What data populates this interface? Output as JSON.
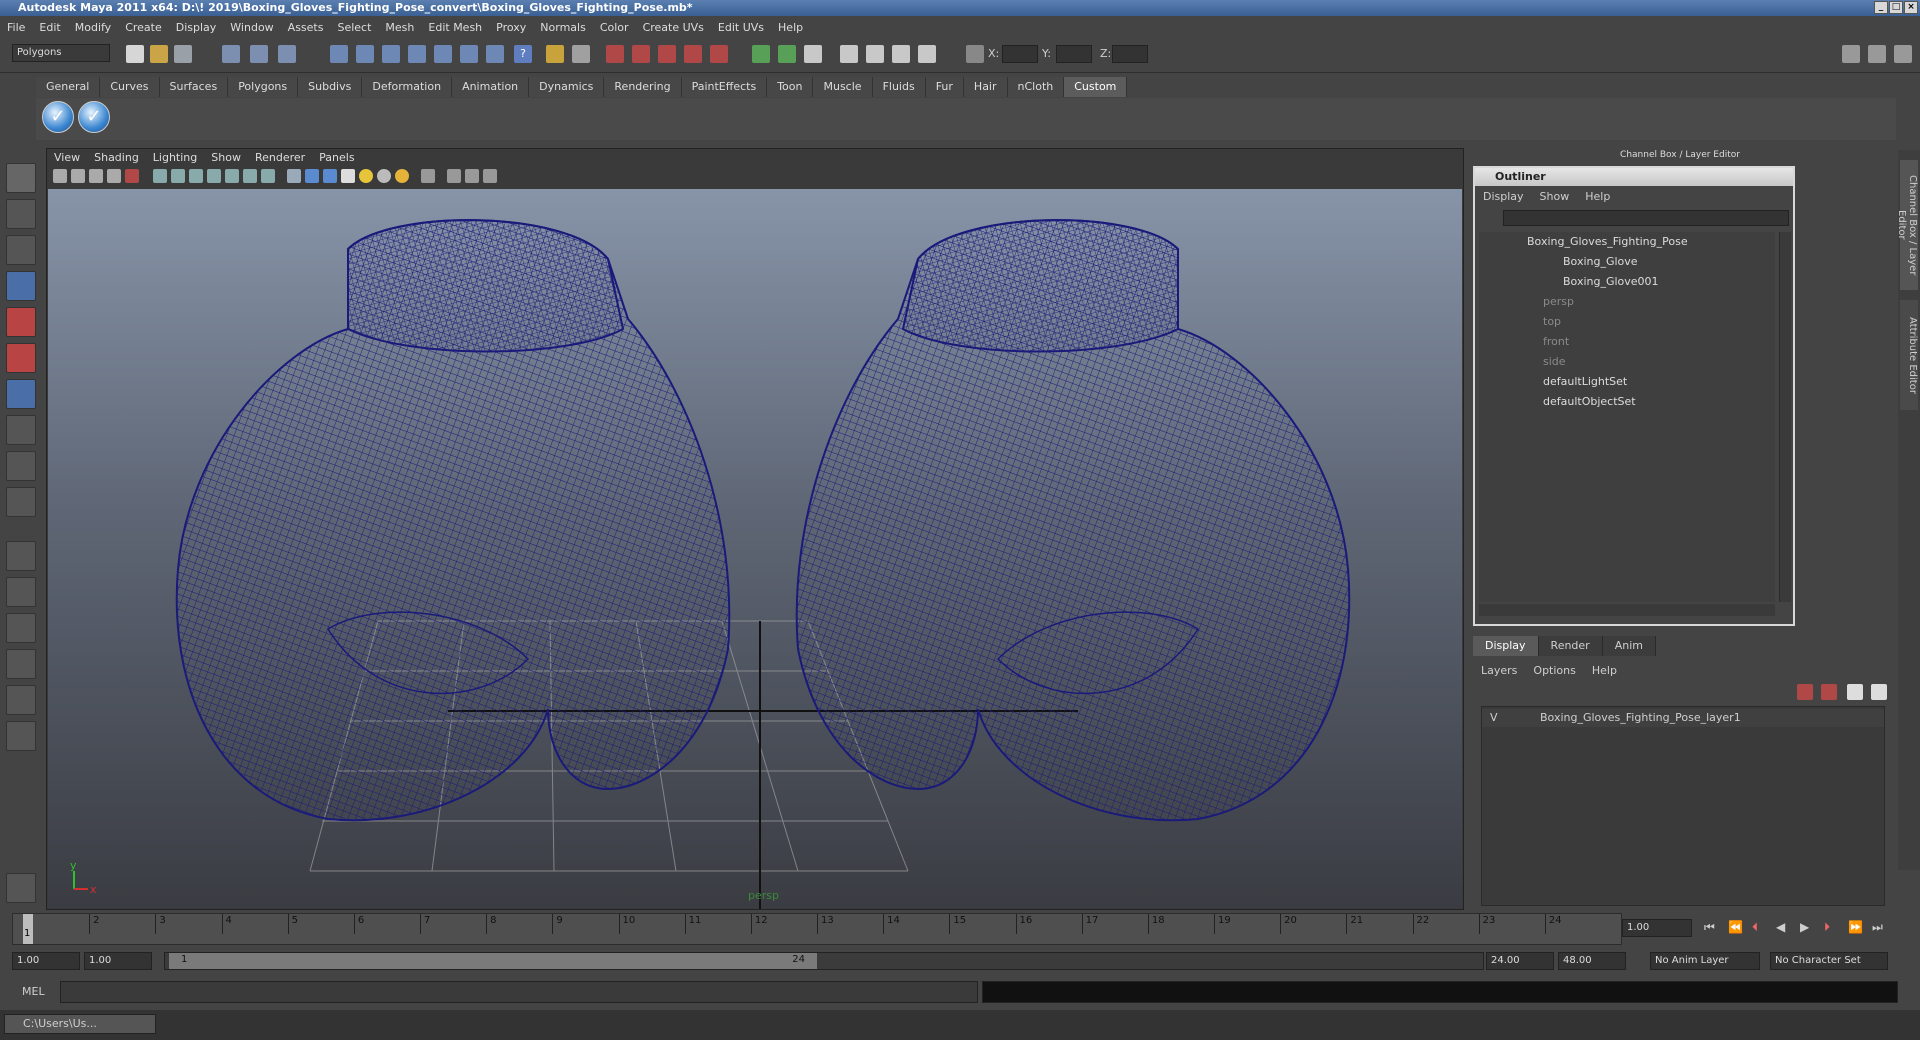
{
  "window": {
    "title": "Autodesk Maya 2011 x64: D:\\! 2019\\Boxing_Gloves_Fighting_Pose_convert\\Boxing_Gloves_Fighting_Pose.mb*"
  },
  "menubar": [
    "File",
    "Edit",
    "Modify",
    "Create",
    "Display",
    "Window",
    "Assets",
    "Select",
    "Mesh",
    "Edit Mesh",
    "Proxy",
    "Normals",
    "Color",
    "Create UVs",
    "Edit UVs",
    "Help"
  ],
  "status": {
    "mode": "Polygons",
    "x_label": "X:",
    "y_label": "Y:",
    "z_label": "Z:"
  },
  "shelf": {
    "tabs": [
      "General",
      "Curves",
      "Surfaces",
      "Polygons",
      "Subdivs",
      "Deformation",
      "Animation",
      "Dynamics",
      "Rendering",
      "PaintEffects",
      "Toon",
      "Muscle",
      "Fluids",
      "Fur",
      "Hair",
      "nCloth",
      "Custom"
    ],
    "active": "Custom"
  },
  "viewport": {
    "menu": [
      "View",
      "Shading",
      "Lighting",
      "Show",
      "Renderer",
      "Panels"
    ],
    "camera_label": "persp",
    "axis_y": "y",
    "axis_x": "x",
    "wire_color": "#1a1a7a"
  },
  "channelbox": {
    "header": "Channel Box / Layer Editor",
    "side_tabs": [
      "Channel Box / Layer Editor",
      "Attribute Editor"
    ]
  },
  "outliner": {
    "title": "Outliner",
    "menu": [
      "Display",
      "Show",
      "Help"
    ],
    "items": [
      {
        "label": "Boxing_Gloves_Fighting_Pose",
        "dim": false
      },
      {
        "label": "Boxing_Glove",
        "dim": false
      },
      {
        "label": "Boxing_Glove001",
        "dim": false
      },
      {
        "label": "persp",
        "dim": true
      },
      {
        "label": "top",
        "dim": true
      },
      {
        "label": "front",
        "dim": true
      },
      {
        "label": "side",
        "dim": true
      },
      {
        "label": "defaultLightSet",
        "dim": false
      },
      {
        "label": "defaultObjectSet",
        "dim": false
      }
    ]
  },
  "layers": {
    "tabs": [
      "Display",
      "Render",
      "Anim"
    ],
    "active": "Display",
    "menu": [
      "Layers",
      "Options",
      "Help"
    ],
    "rows": [
      {
        "visible": "V",
        "name": "Boxing_Gloves_Fighting_Pose_layer1"
      }
    ]
  },
  "timeline": {
    "ticks": [
      "1",
      "2",
      "3",
      "4",
      "5",
      "6",
      "7",
      "8",
      "9",
      "10",
      "11",
      "12",
      "13",
      "14",
      "15",
      "16",
      "17",
      "18",
      "19",
      "20",
      "21",
      "22",
      "23",
      "24"
    ],
    "current": "1",
    "current_field": "1.00"
  },
  "range": {
    "start": "1.00",
    "start2": "1.00",
    "slider_start": "1",
    "slider_end": "24",
    "end": "24.00",
    "end2": "48.00",
    "anim_layer": "No Anim Layer",
    "char_set": "No Character Set"
  },
  "cmd": {
    "label": "MEL"
  },
  "taskbar": {
    "item": "C:\\Users\\Us..."
  }
}
